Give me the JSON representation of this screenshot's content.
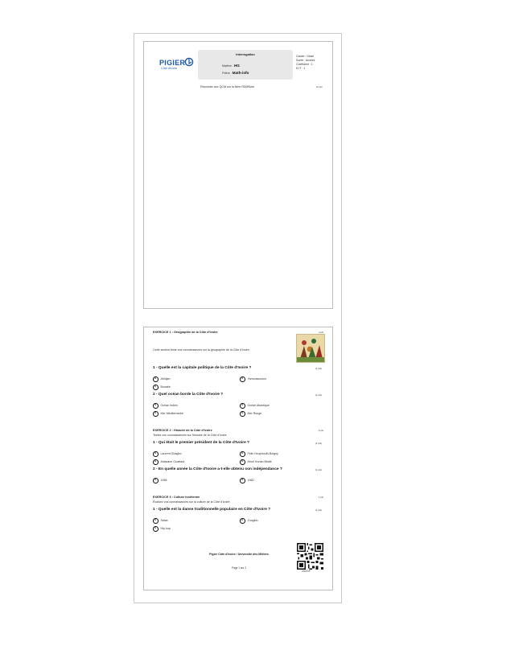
{
  "header": {
    "logo_text": "PIGIER",
    "logo_sub": "Côte d'Ivoire",
    "box_title": "Interrogation",
    "matiere_label": "Matière :",
    "matiere_value": "HG",
    "filiere_label": "Filière :",
    "filiere_value": "Math-info",
    "classe": "Classe : Gesel",
    "duree": "Durée : Années",
    "coefficient": "Coefficient : 1",
    "ect": "ECT : 1"
  },
  "instructions": {
    "text": "Répondre aux QCM sur la fiche RDMNote",
    "points": "21 pts"
  },
  "exercises": [
    {
      "title": "EXERCICE 1 : Géographie de la Côte d'Ivoire",
      "points": "4 pts",
      "description": "Cette section teste vos connaissances sur la géographie de la Côte d'Ivoire.",
      "questions": [
        {
          "text": "1 - Quelle est la capitale politique de la Côte d'Ivoire ?",
          "points": "(1 pts)",
          "options": [
            "Abidjan",
            "Yamoussoukro",
            "Bouaké"
          ]
        },
        {
          "text": "2 - Quel océan borde la Côte d'Ivoire ?",
          "points": "(1 pts)",
          "options": [
            "Océan Indien",
            "Océan Atlantique",
            "Mer Méditerranée",
            "Mer Rouge"
          ]
        }
      ]
    },
    {
      "title": "EXERCICE 2 : Histoire de la Côte d'Ivoire",
      "points": "2 pts",
      "description": "Testez vos connaissances sur l'histoire de la Côte d'Ivoire",
      "questions": [
        {
          "text": "1 - Qui était le premier président de la Côte d'Ivoire ?",
          "points": "(1 pts)",
          "options": [
            "Laurent Gbagbo",
            "Félix Houphouët-Boigny",
            "Alassane Ouattara",
            "Henri Konan Bédié"
          ]
        },
        {
          "text": "2 - En quelle année la Côte d'Ivoire a-t-elle obtenu son indépendance ?",
          "points": "(1 pts)",
          "options": [
            "1958",
            "1960"
          ]
        }
      ]
    },
    {
      "title": "EXERCICE 3 : Culture Ivoirienne",
      "points": "1 pts",
      "description": "Évaluez vos connaissances sur la culture de la Côte d'Ivoire",
      "questions": [
        {
          "text": "1 - Quelle est la danse traditionnelle populaire en Côte d'Ivoire ?",
          "points": "(1 pts)",
          "options": [
            "Salsa",
            "Zouglou",
            "Hip-hop"
          ]
        }
      ]
    }
  ],
  "option_marker": "B",
  "footer": {
    "institution": "Pigier Côte d'Ivoire / Université des Métiers",
    "page": "Page 1 sur 2",
    "qr_code": "20241P"
  }
}
